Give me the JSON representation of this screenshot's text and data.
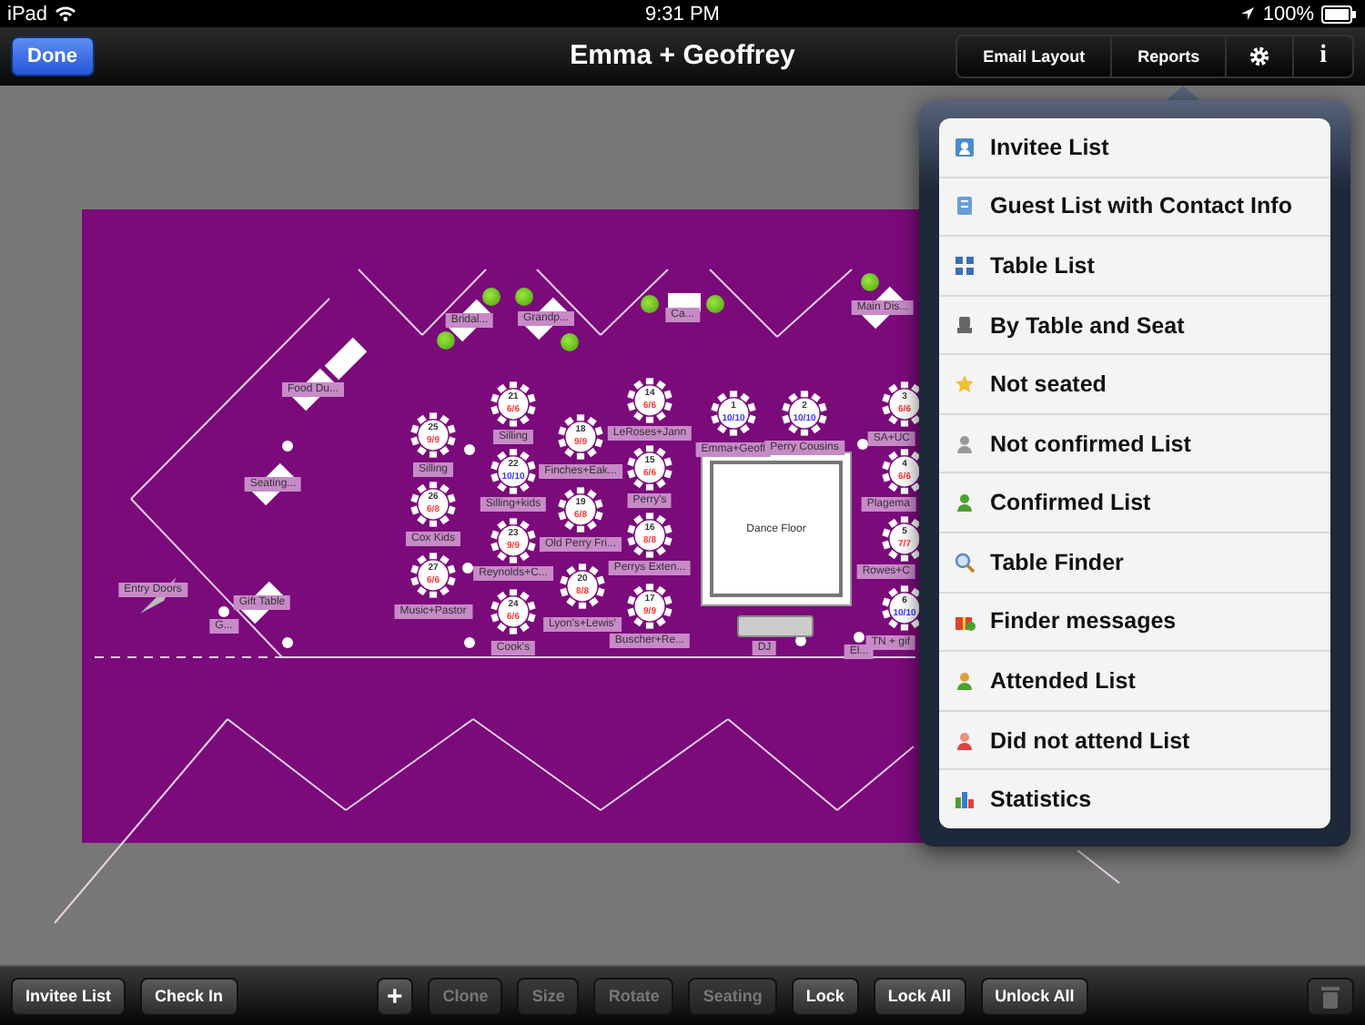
{
  "status_bar": {
    "device": "iPad",
    "time": "9:31 PM",
    "battery": "100%"
  },
  "nav_bar": {
    "done_button": "Done",
    "title": "Emma + Geoffrey",
    "segments": [
      {
        "kind": "text",
        "label": "Email Layout"
      },
      {
        "kind": "text",
        "label": "Reports"
      },
      {
        "kind": "gear"
      },
      {
        "kind": "text",
        "label": "i"
      }
    ]
  },
  "floor_plan": {
    "dance_floor": "Dance Floor",
    "tables": [
      {
        "number": "25",
        "count": "9/9",
        "name": "Silling",
        "color": "#ff3333"
      },
      {
        "number": "26",
        "count": "6/8",
        "name": "Cox Kids",
        "color": "#ff3333"
      },
      {
        "number": "27",
        "count": "6/6",
        "name": "Music+Pastor",
        "color": "#ff3333"
      },
      {
        "number": "21",
        "count": "6/6",
        "name": "Silling",
        "color": "#ff3333"
      },
      {
        "number": "22",
        "count": "10/10",
        "name": "Silling+kids",
        "color": "#3333ff"
      },
      {
        "number": "23",
        "count": "9/9",
        "name": "Reynolds+C...",
        "color": "#ff3333"
      },
      {
        "number": "24",
        "count": "6/6",
        "name": "Cook's",
        "color": "#ff3333"
      },
      {
        "number": "18",
        "count": "9/9",
        "name": "Finches+Eak...",
        "color": "#ff3333"
      },
      {
        "number": "19",
        "count": "6/8",
        "name": "Old Perry Fri...",
        "color": "#ff3333"
      },
      {
        "number": "20",
        "count": "8/8",
        "name": "Lyon's+Lewis'",
        "color": "#ff3333"
      },
      {
        "number": "14",
        "count": "6/6",
        "name": "LeRoses+Jann",
        "color": "#ff3333"
      },
      {
        "number": "15",
        "count": "6/6",
        "name": "Perry's",
        "color": "#ff3333"
      },
      {
        "number": "16",
        "count": "8/8",
        "name": "Perrys Exten...",
        "color": "#ff3333"
      },
      {
        "number": "17",
        "count": "9/9",
        "name": "Buscher+Re...",
        "color": "#ff3333"
      },
      {
        "number": "1",
        "count": "10/10",
        "name": "Emma+Geoff",
        "color": "#3333ff"
      },
      {
        "number": "2",
        "count": "10/10",
        "name": "Perry Cousins",
        "color": "#3333ff"
      },
      {
        "number": "3",
        "count": "6/6",
        "name": "SA+UC",
        "color": "#ff3333"
      },
      {
        "number": "4",
        "count": "6/6",
        "name": "Plagema",
        "color": "#ff3333"
      },
      {
        "number": "5",
        "count": "7/7",
        "name": "Rowes+C",
        "color": "#ff3333"
      },
      {
        "number": "6",
        "count": "10/10",
        "name": "TN + gif",
        "color": "#3333ff"
      }
    ],
    "objects": [
      {
        "kind": "furniture",
        "label": "Bridal..."
      },
      {
        "kind": "furniture",
        "label": "Grandp..."
      },
      {
        "kind": "cake",
        "label": "Ca..."
      },
      {
        "kind": "furniture",
        "label": "Main Dis..."
      },
      {
        "kind": "furniture",
        "label": "Food Du..."
      },
      {
        "kind": "furniture",
        "label": "Seating..."
      },
      {
        "kind": "door",
        "label": "Entry Doors"
      },
      {
        "kind": "furniture",
        "label": "Gift Table"
      },
      {
        "kind": "marker",
        "label": "G..."
      },
      {
        "kind": "marker",
        "label": "El..."
      },
      {
        "kind": "dj",
        "label": "DJ"
      }
    ]
  },
  "reports_menu": {
    "items": [
      "Invitee List",
      "Guest List with Contact Info",
      "Table List",
      "By Table and Seat",
      "Not seated",
      "Not confirmed List",
      "Confirmed List",
      "Table Finder",
      "Finder messages",
      "Attended List",
      "Did not attend List",
      "Statistics"
    ]
  },
  "toolbar": {
    "left_buttons": [
      {
        "label": "Invitee List",
        "disabled": false
      },
      {
        "label": "Check In",
        "disabled": false
      }
    ],
    "edit_buttons": [
      {
        "label": "+",
        "disabled": false
      },
      {
        "label": "Clone",
        "disabled": true
      },
      {
        "label": "Size",
        "disabled": true
      },
      {
        "label": "Rotate",
        "disabled": true
      },
      {
        "label": "Seating",
        "disabled": true
      },
      {
        "label": "Lock",
        "disabled": false
      },
      {
        "label": "Lock All",
        "disabled": false
      },
      {
        "label": "Unlock All",
        "disabled": false
      }
    ],
    "trash": {
      "disabled": true
    }
  }
}
